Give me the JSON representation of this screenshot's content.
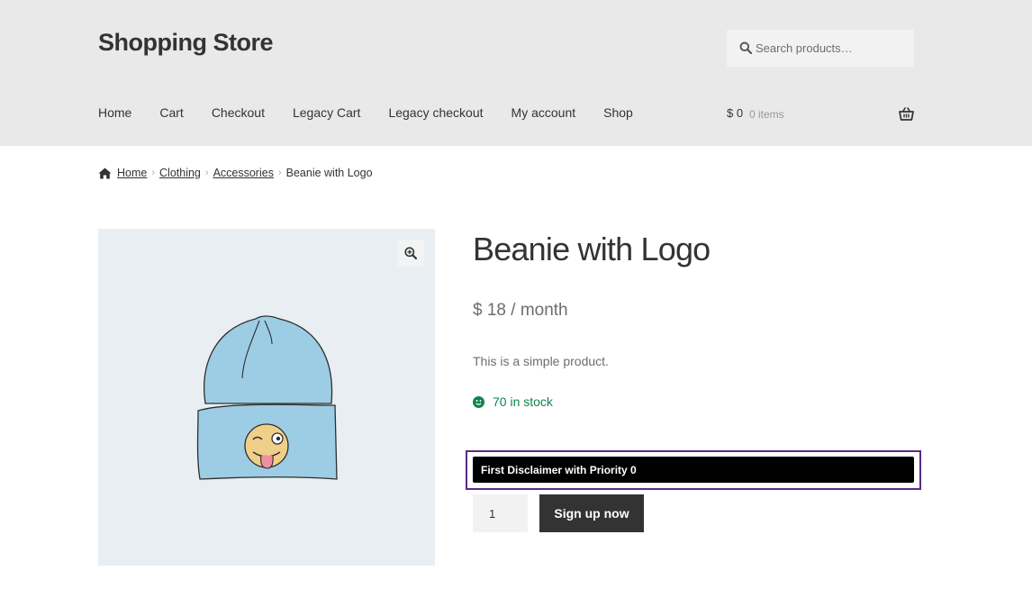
{
  "site": {
    "title": "Shopping Store"
  },
  "search": {
    "placeholder": "Search products…",
    "icon": "search-icon"
  },
  "nav": {
    "items": [
      {
        "label": "Home"
      },
      {
        "label": "Cart"
      },
      {
        "label": "Checkout"
      },
      {
        "label": "Legacy Cart"
      },
      {
        "label": "Legacy checkout"
      },
      {
        "label": "My account"
      },
      {
        "label": "Shop"
      }
    ]
  },
  "mini_cart": {
    "total": "$ 0",
    "count": "0 items",
    "icon": "basket-icon"
  },
  "breadcrumb": {
    "items": [
      {
        "label": "Home"
      },
      {
        "label": "Clothing"
      },
      {
        "label": "Accessories"
      }
    ],
    "current": "Beanie with Logo"
  },
  "product": {
    "title": "Beanie with Logo",
    "price": "$ 18 / month",
    "description": "This is a simple product.",
    "stock": "70 in stock",
    "disclaimer": "First Disclaimer with Priority 0",
    "quantity": "1",
    "button_label": "Sign up now"
  },
  "colors": {
    "header_bg": "#e9e9e9",
    "gallery_bg": "#e8eef2",
    "stock_green": "#0f834d",
    "disclaimer_border": "#5b2a86",
    "button_bg": "#333333"
  }
}
